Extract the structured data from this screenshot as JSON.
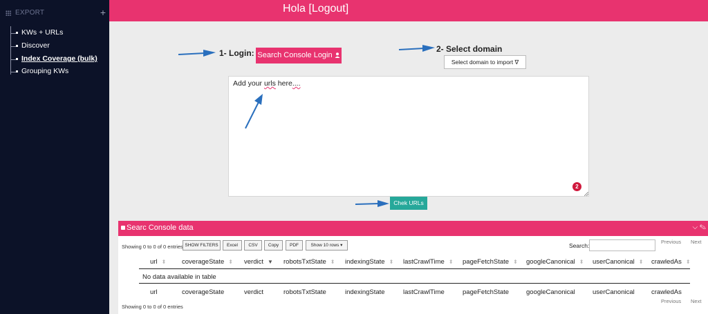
{
  "sidebar": {
    "header_label": "EXPORT",
    "header_action": "+",
    "items": [
      {
        "label": "KWs + URLs",
        "active": false
      },
      {
        "label": "Discover",
        "active": false
      },
      {
        "label": "Index Coverage (bulk)",
        "active": true
      },
      {
        "label": "Grouping KWs",
        "active": false
      }
    ]
  },
  "topbar": {
    "greeting": "Hola",
    "bracket_open": "[",
    "logout_label": "Logout",
    "bracket_close": "]"
  },
  "steps": {
    "login_label": "1- Login:",
    "login_button": "Search Console Login",
    "domain_label": "2- Select domain",
    "domain_select": "Select domain to import ∇"
  },
  "urls_input": {
    "placeholder_prefix": "Add your ",
    "placeholder_word": "urls",
    "placeholder_middle": " here",
    "placeholder_suffix": "....",
    "badge": "2"
  },
  "check_button": "Chek URLs",
  "panel": {
    "title": "Searc Console data",
    "controls": "⌵ ✎",
    "info_top": "Showing 0 to 0 of 0 entries",
    "info_bottom": "Showing 0 to 0 of 0 entries",
    "buttons": [
      "SHOW FILTERS",
      "Excel",
      "CSV",
      "Copy",
      "PDF",
      "Show 10 rows ▾"
    ],
    "search_label": "Search:",
    "previous": "Previous",
    "next": "Next",
    "columns": [
      "url",
      "coverageState",
      "verdict",
      "robotsTxtState",
      "indexingState",
      "lastCrawlTime",
      "pageFetchState",
      "googleCanonical",
      "userCanonical",
      "crawledAs"
    ],
    "empty_message": "No data available in table"
  },
  "colors": {
    "accent": "#e8336f",
    "sidebar_bg": "#0c1228",
    "check_button": "#26a89a",
    "arrow": "#2a6fbd"
  }
}
